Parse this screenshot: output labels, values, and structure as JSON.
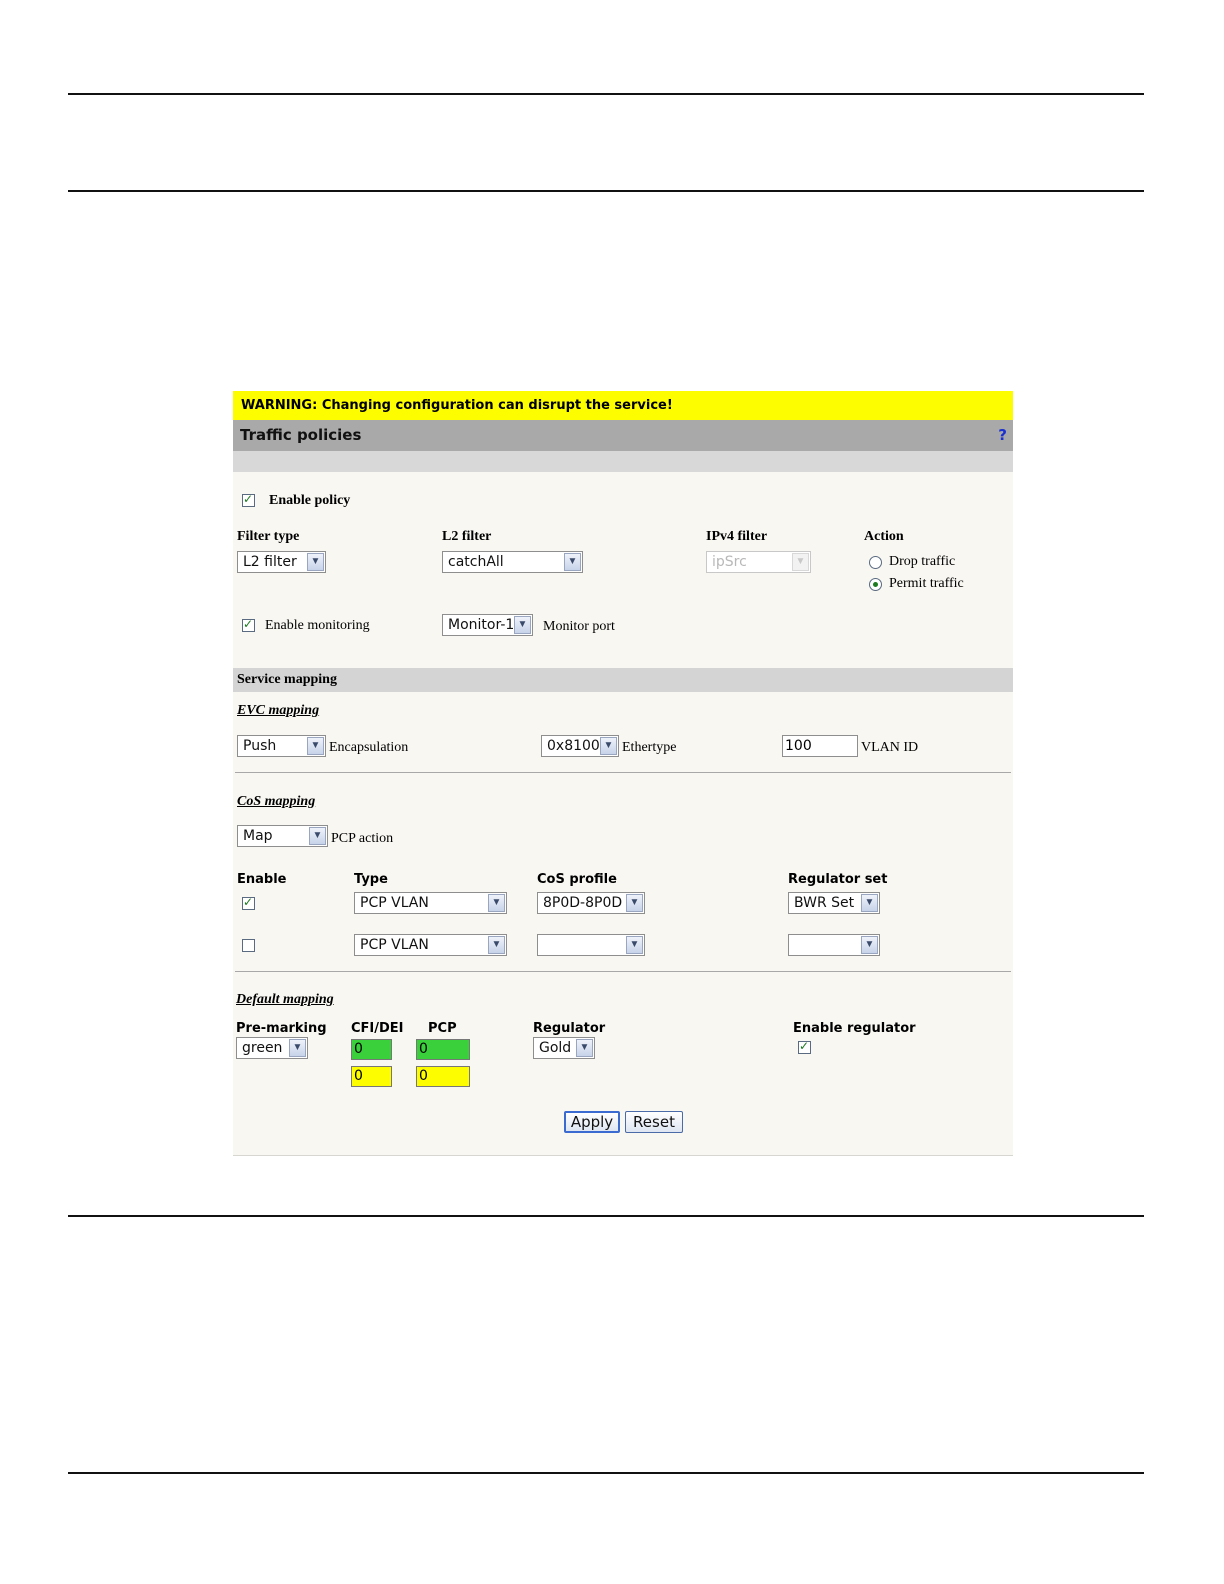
{
  "warning": "WARNING: Changing configuration can disrupt the service!",
  "title": "Traffic policies",
  "help": "?",
  "policy": {
    "enable_policy_label": "Enable policy",
    "enable_policy_checked": true,
    "filter_type_label": "Filter type",
    "filter_type_value": "L2 filter",
    "l2_filter_label": "L2 filter",
    "l2_filter_value": "catchAll",
    "ipv4_filter_label": "IPv4 filter",
    "ipv4_filter_value": "ipSrc",
    "action_label": "Action",
    "action_drop": "Drop traffic",
    "action_permit": "Permit traffic",
    "action_selected": "Permit traffic",
    "enable_monitoring_label": "Enable monitoring",
    "enable_monitoring_checked": true,
    "monitor_value": "Monitor-1",
    "monitor_port_label": "Monitor port"
  },
  "service_mapping": {
    "title": "Service mapping",
    "evc_title": "EVC mapping",
    "encapsulation_value": "Push",
    "encapsulation_label": "Encapsulation",
    "ethertype_value": "0x8100",
    "ethertype_label": "Ethertype",
    "vlan_id_value": "100",
    "vlan_id_label": "VLAN ID"
  },
  "cos_mapping": {
    "title": "CoS mapping",
    "pcp_action_value": "Map",
    "pcp_action_label": "PCP action",
    "headers": {
      "enable": "Enable",
      "type": "Type",
      "cos_profile": "CoS profile",
      "regulator_set": "Regulator set"
    },
    "rows": [
      {
        "enabled": true,
        "type": "PCP VLAN",
        "cos_profile": "8P0D-8P0D",
        "regulator_set": "BWR Set"
      },
      {
        "enabled": false,
        "type": "PCP VLAN",
        "cos_profile": "",
        "regulator_set": ""
      }
    ]
  },
  "default_mapping": {
    "title": "Default mapping",
    "headers": {
      "pre_marking": "Pre-marking",
      "cfi_dei": "CFI/DEI",
      "pcp": "PCP",
      "regulator": "Regulator",
      "enable_regulator": "Enable regulator"
    },
    "pre_marking_value": "green",
    "green_row": {
      "cfi_dei": "0",
      "pcp": "0"
    },
    "yellow_row": {
      "cfi_dei": "0",
      "pcp": "0"
    },
    "regulator_value": "Gold",
    "enable_regulator_checked": true,
    "colors": {
      "green": "#39d03b",
      "yellow": "#fdfd00"
    }
  },
  "buttons": {
    "apply": "Apply",
    "reset": "Reset"
  }
}
